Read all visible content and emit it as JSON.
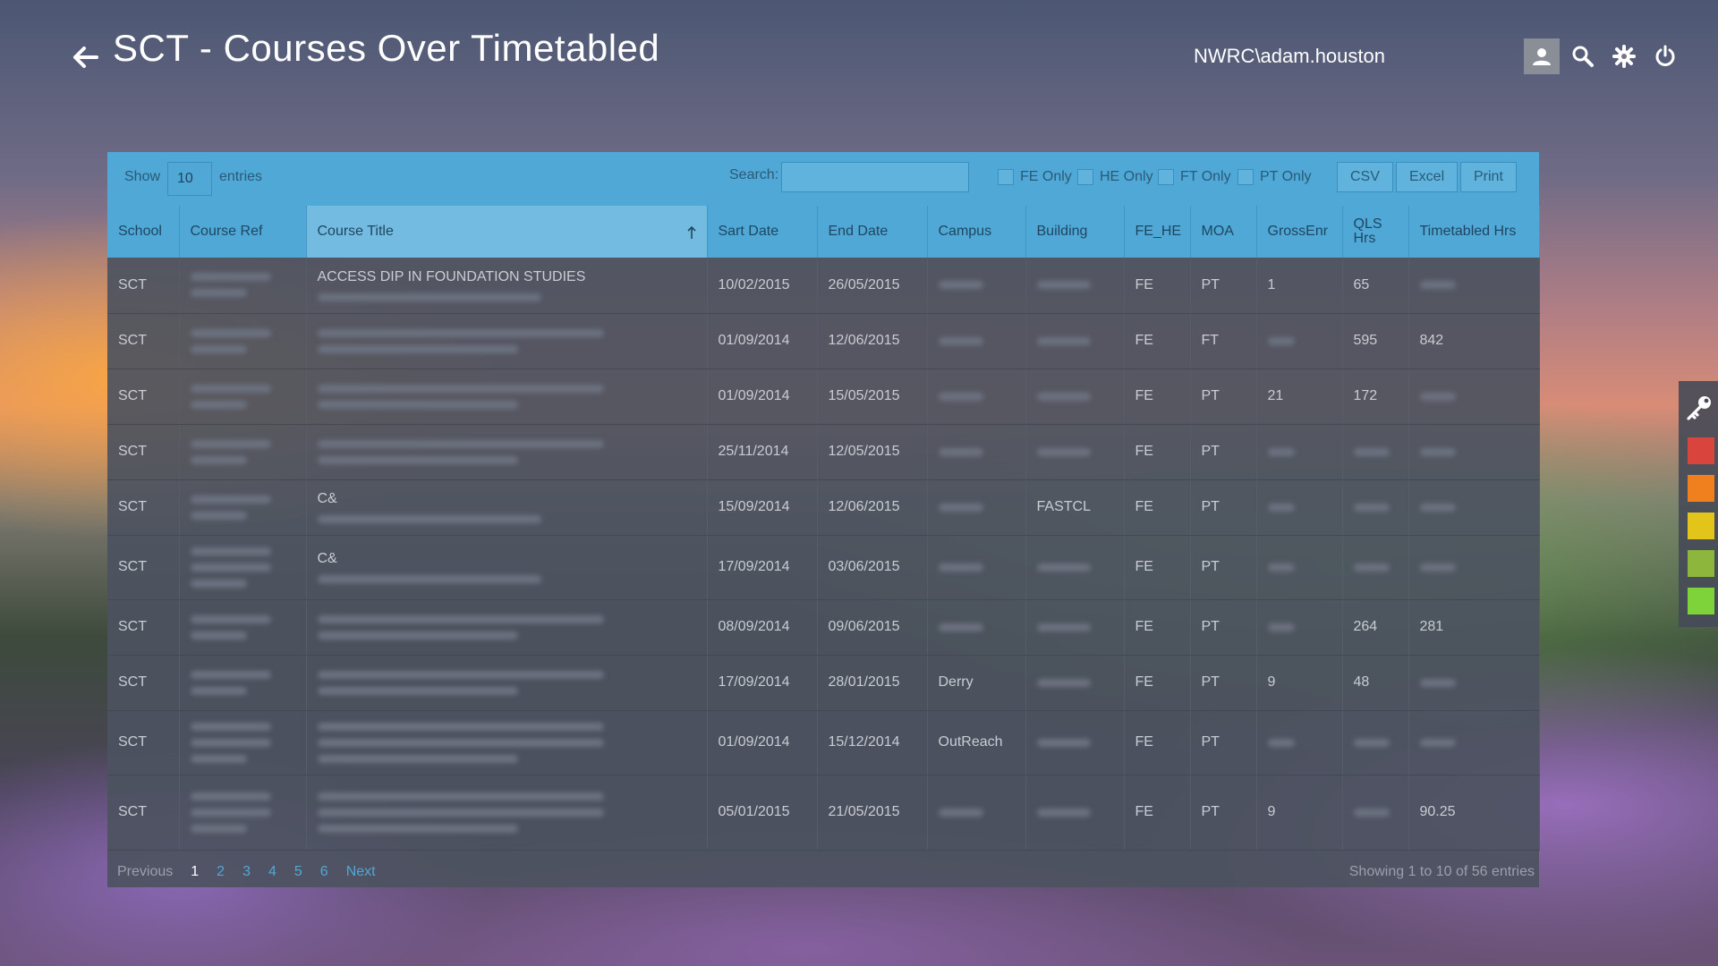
{
  "header": {
    "title": "SCT - Courses Over Timetabled",
    "user": "NWRC\\adam.houston",
    "icons": [
      "back-arrow-icon",
      "user-icon",
      "search-icon",
      "gear-icon",
      "power-icon"
    ]
  },
  "toolbar": {
    "show_label": "Show",
    "entries_value": "10",
    "entries_label": "entries",
    "search_label": "Search:",
    "search_value": "",
    "filters": [
      "FE Only",
      "HE Only",
      "FT Only",
      "PT Only"
    ],
    "buttons": [
      "CSV",
      "Excel",
      "Print"
    ]
  },
  "table": {
    "columns": [
      "School",
      "Course Ref",
      "Course Title",
      "Sart Date",
      "End Date",
      "Campus",
      "Building",
      "FE_HE",
      "MOA",
      "GrossEnr",
      "QLS Hrs",
      "Timetabled Hrs"
    ],
    "sorted_column": "Course Title",
    "rows": [
      {
        "school": "SCT",
        "ref": "",
        "title": "ACCESS DIP IN FOUNDATION STUDIES",
        "start": "10/02/2015",
        "end": "26/05/2015",
        "campus": "",
        "building": "",
        "fe_he": "FE",
        "moa": "PT",
        "gross": "1",
        "qls": "65",
        "tt": ""
      },
      {
        "school": "SCT",
        "ref": "",
        "title": "",
        "start": "01/09/2014",
        "end": "12/06/2015",
        "campus": "",
        "building": "",
        "fe_he": "FE",
        "moa": "FT",
        "gross": "",
        "qls": "595",
        "tt": "842"
      },
      {
        "school": "SCT",
        "ref": "",
        "title": "",
        "start": "01/09/2014",
        "end": "15/05/2015",
        "campus": "",
        "building": "",
        "fe_he": "FE",
        "moa": "PT",
        "gross": "21",
        "qls": "172",
        "tt": ""
      },
      {
        "school": "SCT",
        "ref": "",
        "title": "",
        "start": "25/11/2014",
        "end": "12/05/2015",
        "campus": "",
        "building": "",
        "fe_he": "FE",
        "moa": "PT",
        "gross": "",
        "qls": "",
        "tt": ""
      },
      {
        "school": "SCT",
        "ref": "",
        "title": "C&",
        "start": "15/09/2014",
        "end": "12/06/2015",
        "campus": "",
        "building": "FASTCL",
        "fe_he": "FE",
        "moa": "PT",
        "gross": "",
        "qls": "",
        "tt": ""
      },
      {
        "school": "SCT",
        "ref": "",
        "title": "C&",
        "start": "17/09/2014",
        "end": "03/06/2015",
        "campus": "",
        "building": "",
        "fe_he": "FE",
        "moa": "PT",
        "gross": "",
        "qls": "",
        "tt": ""
      },
      {
        "school": "SCT",
        "ref": "",
        "title": "",
        "start": "08/09/2014",
        "end": "09/06/2015",
        "campus": "",
        "building": "",
        "fe_he": "FE",
        "moa": "PT",
        "gross": "",
        "qls": "264",
        "tt": "281"
      },
      {
        "school": "SCT",
        "ref": "",
        "title": "",
        "start": "17/09/2014",
        "end": "28/01/2015",
        "campus": "Derry",
        "building": "",
        "fe_he": "FE",
        "moa": "PT",
        "gross": "9",
        "qls": "48",
        "tt": ""
      },
      {
        "school": "SCT",
        "ref": "",
        "title": "",
        "start": "01/09/2014",
        "end": "15/12/2014",
        "campus": "OutReach",
        "building": "",
        "fe_he": "FE",
        "moa": "PT",
        "gross": "",
        "qls": "",
        "tt": ""
      },
      {
        "school": "SCT",
        "ref": "",
        "title": "",
        "start": "05/01/2015",
        "end": "21/05/2015",
        "campus": "",
        "building": "",
        "fe_he": "FE",
        "moa": "PT",
        "gross": "9",
        "qls": "",
        "tt": "90.25"
      }
    ]
  },
  "pagination": {
    "previous": "Previous",
    "pages": [
      "1",
      "2",
      "3",
      "4",
      "5",
      "6"
    ],
    "current": "1",
    "next": "Next",
    "info": "Showing 1 to 10 of 56 entries"
  },
  "dock": {
    "icon": "key-icon",
    "swatches": [
      "#d9443c",
      "#f0801e",
      "#e3c41a",
      "#8cb63c",
      "#7ed23a"
    ]
  }
}
